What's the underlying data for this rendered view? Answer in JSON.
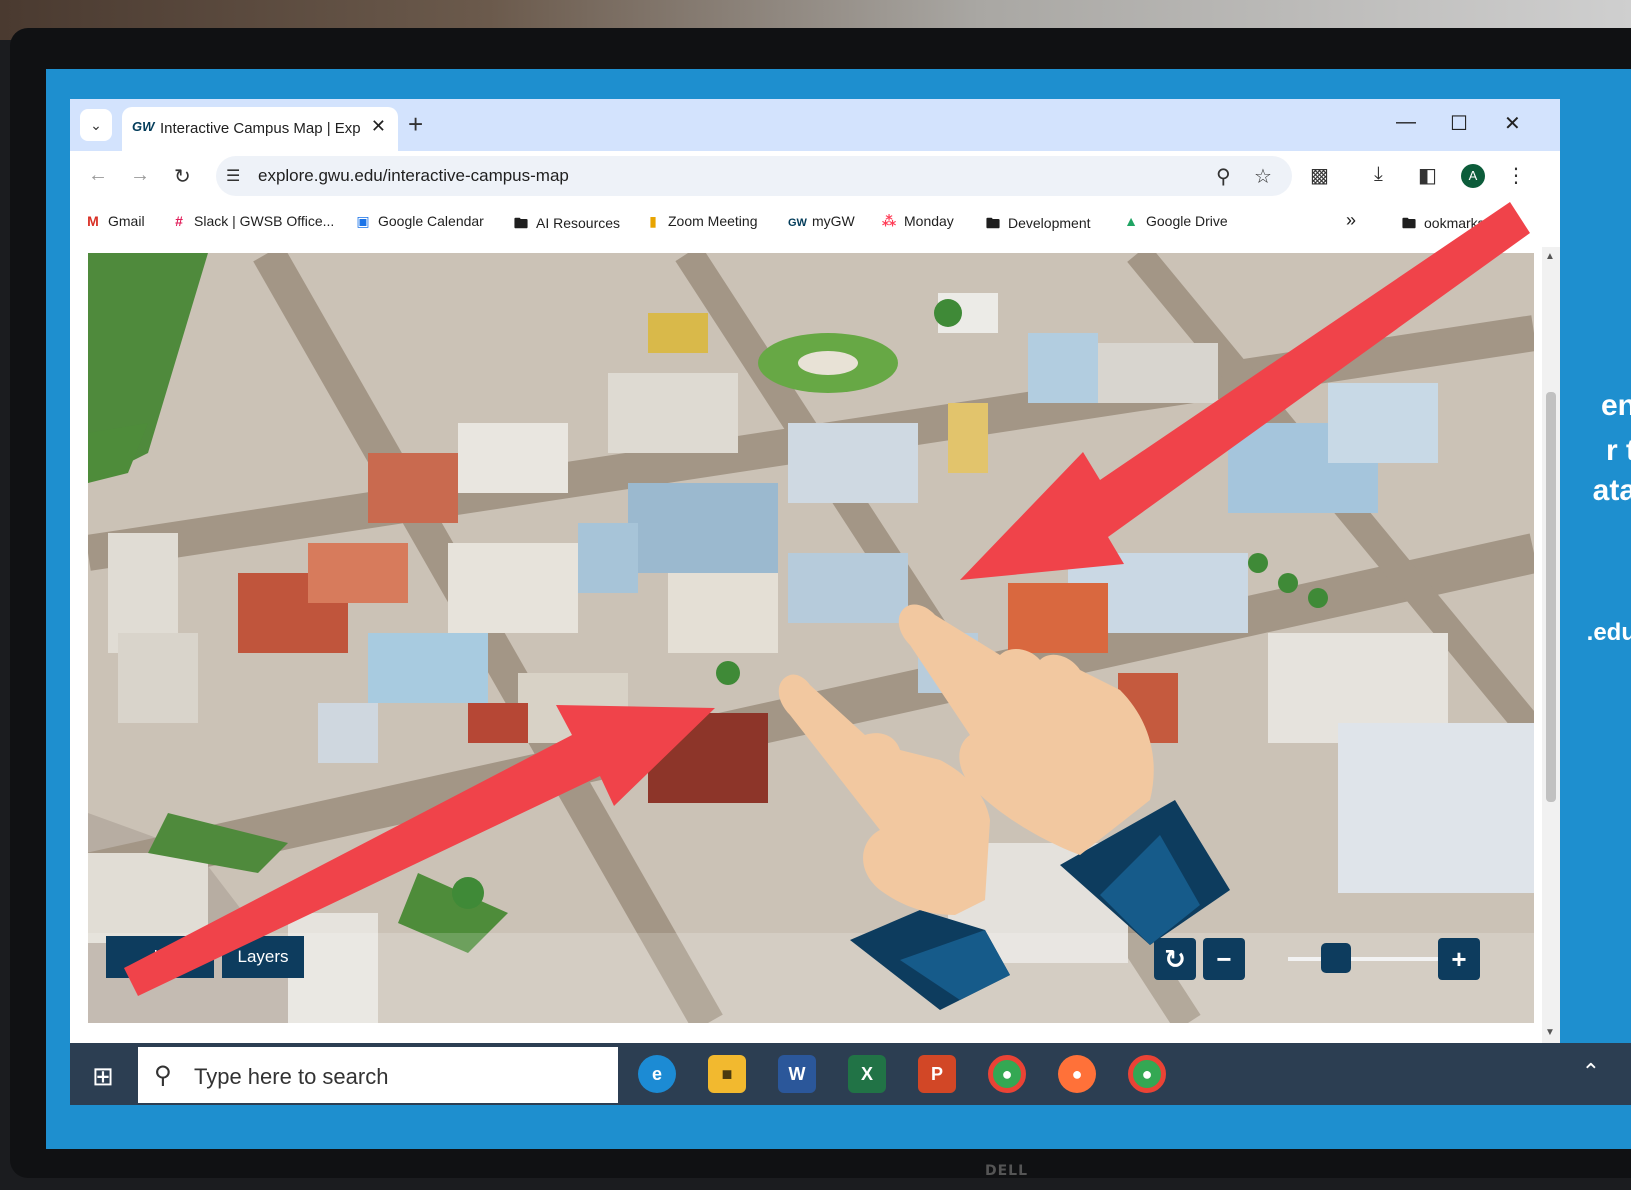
{
  "browser": {
    "tab_title": "Interactive Campus Map | Explo",
    "tab_favicon": "GW",
    "url": "explore.gwu.edu/interactive-campus-map",
    "profile_initial": "A"
  },
  "bookmarks": [
    {
      "label": "Gmail",
      "icon": "gmail-icon"
    },
    {
      "label": "Slack | GWSB Office...",
      "icon": "slack-icon"
    },
    {
      "label": "Google Calendar",
      "icon": "calendar-icon"
    },
    {
      "label": "AI Resources",
      "icon": "folder-icon"
    },
    {
      "label": "Zoom Meeting",
      "icon": "zoom-icon"
    },
    {
      "label": "myGW",
      "icon": "gw-icon"
    },
    {
      "label": "Monday",
      "icon": "monday-icon"
    },
    {
      "label": "Development",
      "icon": "folder-icon"
    },
    {
      "label": "Google Drive",
      "icon": "drive-icon"
    }
  ],
  "bookmarks_overflow": "»",
  "all_bookmarks_label": "ookmarks",
  "map": {
    "left_button_partial": "ls",
    "layers_label": "Layers",
    "zoom_level": 0.27,
    "reset_icon": "refresh-icon",
    "zoom_out_icon": "minus-icon",
    "zoom_in_icon": "plus-icon"
  },
  "side_text": [
    "en",
    "r t",
    "ata",
    ".edu"
  ],
  "taskbar": {
    "search_placeholder": "Type here to search",
    "apps": [
      "edge-icon",
      "file-explorer-icon",
      "word-icon",
      "excel-icon",
      "powerpoint-icon",
      "chrome-icon",
      "firefox-icon",
      "chrome-icon"
    ]
  },
  "monitor_brand": "DELL",
  "colors": {
    "brand_navy": "#0d3c5e",
    "arrow_red": "#f0434a",
    "screen_bg_blue": "#1e8fcf",
    "tab_strip": "#d3e3fd",
    "skin": "#f2c8a0"
  }
}
